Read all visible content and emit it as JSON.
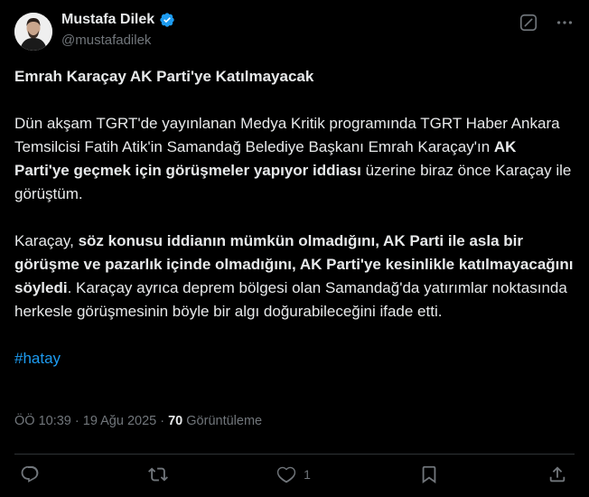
{
  "author": {
    "name": "Mustafa Dilek",
    "handle": "@mustafadilek"
  },
  "post": {
    "title": "Emrah Karaçay AK Parti'ye Katılmayacak",
    "p1": {
      "a": "Dün akşam TGRT'de yayınlanan Medya Kritik programında TGRT Haber Ankara Temsilcisi Fatih Atik'in Samandağ Belediye Başkanı Emrah Karaçay'ın ",
      "b": "AK Parti'ye geçmek için görüşmeler yapıyor iddiası",
      "c": " üzerine biraz önce Karaçay ile görüştüm."
    },
    "p2": {
      "a": "Karaçay, ",
      "b": "söz konusu iddianın mümkün olmadığını, AK Parti ile asla bir görüşme ve pazarlık içinde olmadığını, AK Parti'ye kesinlikle katılmayacağını söyledi",
      "c": ". Karaçay ayrıca deprem bölgesi olan Samandağ'da yatırımlar noktasında herkesle görüşmesinin böyle bir algı doğurabileceğini ifade etti."
    },
    "hashtag": "#hatay"
  },
  "meta": {
    "time": "ÖÖ 10:39",
    "separator1": " · ",
    "date": "19 Ağu 2025",
    "separator2": " · ",
    "views": "70",
    "views_label": " Görüntüleme"
  },
  "actions": {
    "likes": "1"
  },
  "colors": {
    "background": "#000000",
    "text": "#e7e9ea",
    "secondary": "#71767b",
    "accent": "#1d9bf0",
    "divider": "#2f3336"
  }
}
